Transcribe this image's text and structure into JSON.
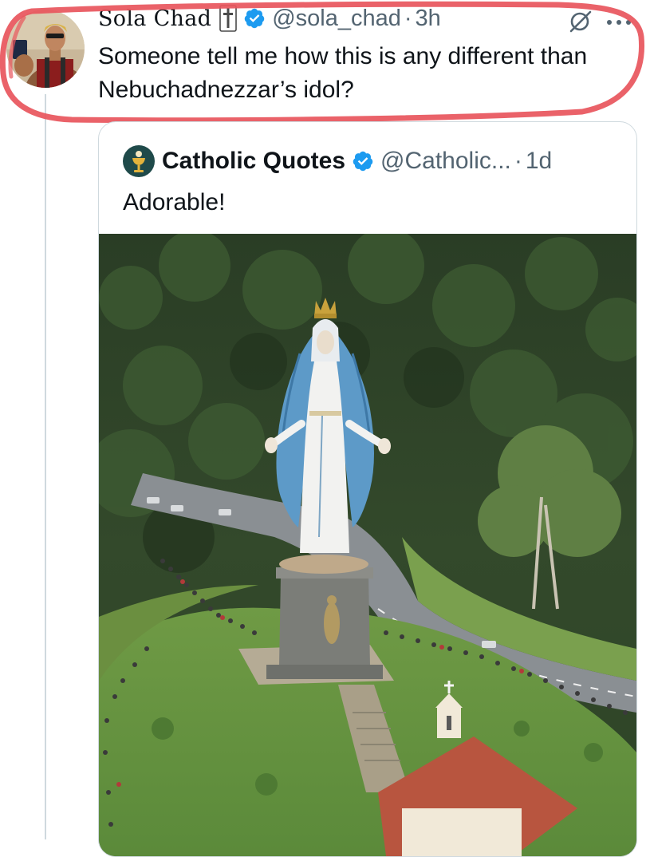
{
  "post": {
    "display_name": "Sola Chad",
    "handle": "@sola_chad",
    "separator": "·",
    "timestamp": "3h",
    "text": "Someone tell me how this is any different than Nebuchadnezzar’s idol?",
    "more_icon": "more-horizontal-icon",
    "grok_icon": "grok-icon",
    "badge_icon": "cross-badge-icon",
    "verified_icon": "verified-badge-icon"
  },
  "quote": {
    "display_name": "Catholic Quotes",
    "handle": "@Catholic...",
    "separator": "·",
    "timestamp": "1d",
    "text": "Adorable!",
    "avatar_icon": "chalice-avatar"
  },
  "colors": {
    "verified": "#1d9bf0",
    "secondary_text": "#536471",
    "highlight_ring": "#e8555c",
    "border": "#cfd9de"
  }
}
